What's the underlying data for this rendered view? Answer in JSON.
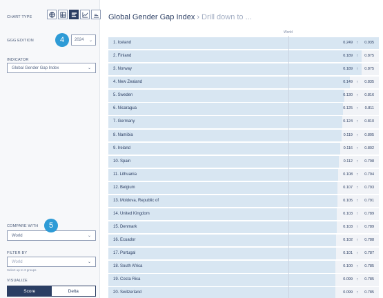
{
  "sidebar": {
    "chart_type_label": "CHART TYPE",
    "chart_types": [
      {
        "icon": "map-icon",
        "active": false
      },
      {
        "icon": "table-icon",
        "active": false
      },
      {
        "icon": "bar-chart-icon",
        "active": true
      },
      {
        "icon": "line-chart-icon",
        "active": false
      },
      {
        "icon": "column-chart-icon",
        "active": false
      }
    ],
    "edition_label": "GGG EDITION",
    "edition_value": "2024",
    "indicator_label": "INDICATOR",
    "indicator_value": "Global Gender Gap Index",
    "compare_label": "COMPARE WITH",
    "compare_value": "World",
    "filter_label": "FILTER BY",
    "filter_placeholder": "World",
    "filter_hint": "Select up to 3 groups",
    "visualize_label": "VISUALIZE",
    "visualize_options": [
      "Score",
      "Delta"
    ],
    "visualize_selected": "Score"
  },
  "badges": [
    "4",
    "5"
  ],
  "header": {
    "title": "Global Gender Gap Index",
    "separator": "›",
    "drill": "Drill down to ..."
  },
  "reference_label": "World",
  "rows": [
    {
      "rank_name": "1. Iceland",
      "gap": "0.249",
      "score": "0.935",
      "fill": 1.0
    },
    {
      "rank_name": "2. Finland",
      "gap": "0.189",
      "score": "0.875",
      "fill": 0.936
    },
    {
      "rank_name": "3. Norway",
      "gap": "0.189",
      "score": "0.875",
      "fill": 0.936
    },
    {
      "rank_name": "4. New Zealand",
      "gap": "0.149",
      "score": "0.835",
      "fill": 0.893
    },
    {
      "rank_name": "5. Sweden",
      "gap": "0.130",
      "score": "0.816",
      "fill": 0.873
    },
    {
      "rank_name": "6. Nicaragua",
      "gap": "0.125",
      "score": "0.811",
      "fill": 0.867
    },
    {
      "rank_name": "7. Germany",
      "gap": "0.124",
      "score": "0.810",
      "fill": 0.866
    },
    {
      "rank_name": "8. Namibia",
      "gap": "0.119",
      "score": "0.805",
      "fill": 0.861
    },
    {
      "rank_name": "9. Ireland",
      "gap": "0.116",
      "score": "0.802",
      "fill": 0.858
    },
    {
      "rank_name": "10. Spain",
      "gap": "0.112",
      "score": "0.798",
      "fill": 0.853
    },
    {
      "rank_name": "11. Lithuania",
      "gap": "0.108",
      "score": "0.794",
      "fill": 0.849
    },
    {
      "rank_name": "12. Belgium",
      "gap": "0.107",
      "score": "0.793",
      "fill": 0.848
    },
    {
      "rank_name": "13. Moldova, Republic of",
      "gap": "0.105",
      "score": "0.791",
      "fill": 0.846
    },
    {
      "rank_name": "14. United Kingdom",
      "gap": "0.103",
      "score": "0.789",
      "fill": 0.844
    },
    {
      "rank_name": "15. Denmark",
      "gap": "0.103",
      "score": "0.789",
      "fill": 0.844
    },
    {
      "rank_name": "16. Ecuador",
      "gap": "0.102",
      "score": "0.788",
      "fill": 0.843
    },
    {
      "rank_name": "17. Portugal",
      "gap": "0.101",
      "score": "0.787",
      "fill": 0.842
    },
    {
      "rank_name": "18. South Africa",
      "gap": "0.100",
      "score": "0.785",
      "fill": 0.84
    },
    {
      "rank_name": "19. Costa Rica",
      "gap": "0.099",
      "score": "0.785",
      "fill": 0.84
    },
    {
      "rank_name": "20. Switzerland",
      "gap": "0.099",
      "score": "0.785",
      "fill": 0.84
    }
  ],
  "up_arrow": "↑",
  "colors": {
    "navy": "#2b3e63",
    "badge": "#2e9bd6",
    "bar": "#d8e6f2",
    "row_bg": "#f1f3f7"
  }
}
